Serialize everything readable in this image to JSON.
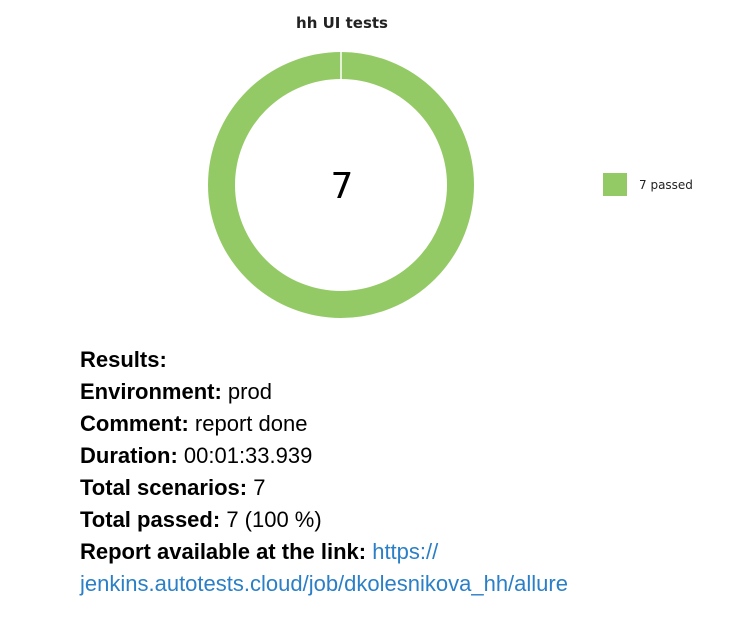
{
  "chart_data": {
    "type": "pie",
    "title": "hh UI tests",
    "center_label": "7",
    "slices": [
      {
        "label": "passed",
        "value": 7,
        "color": "#94ca66"
      }
    ],
    "legend": [
      "7 passed"
    ],
    "legend_placement": "right"
  },
  "info": {
    "results_label": "Results:",
    "environment_label": "Environment:",
    "environment_value": "prod",
    "comment_label": "Comment:",
    "comment_value": "report done",
    "duration_label": "Duration:",
    "duration_value": "00:01:33.939",
    "scenarios_label": "Total scenarios:",
    "scenarios_value": "7",
    "passed_label": "Total passed:",
    "passed_value": "7 (100 %)",
    "report_label": "Report available at the link:",
    "report_link_1": "https://",
    "report_link_2": "jenkins.autotests.cloud/job/dkolesnikova_hh/allure"
  }
}
